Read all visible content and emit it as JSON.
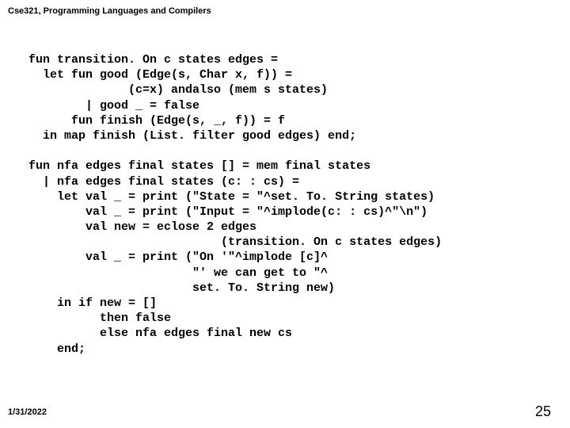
{
  "header": {
    "title": "Cse321, Programming Languages and Compilers"
  },
  "code": {
    "lines": "fun transition. On c states edges =\n  let fun good (Edge(s, Char x, f)) =\n              (c=x) andalso (mem s states)\n        | good _ = false\n      fun finish (Edge(s, _, f)) = f\n  in map finish (List. filter good edges) end;\n\nfun nfa edges final states [] = mem final states\n  | nfa edges final states (c: : cs) =\n    let val _ = print (\"State = \"^set. To. String states)\n        val _ = print (\"Input = \"^implode(c: : cs)^\"\\n\")\n        val new = eclose 2 edges\n                           (transition. On c states edges)\n        val _ = print (\"On '\"^implode [c]^\n                       \"' we can get to \"^\n                       set. To. String new)\n    in if new = []\n          then false\n          else nfa edges final new cs\n    end;"
  },
  "footer": {
    "date": "1/31/2022",
    "page": "25"
  }
}
